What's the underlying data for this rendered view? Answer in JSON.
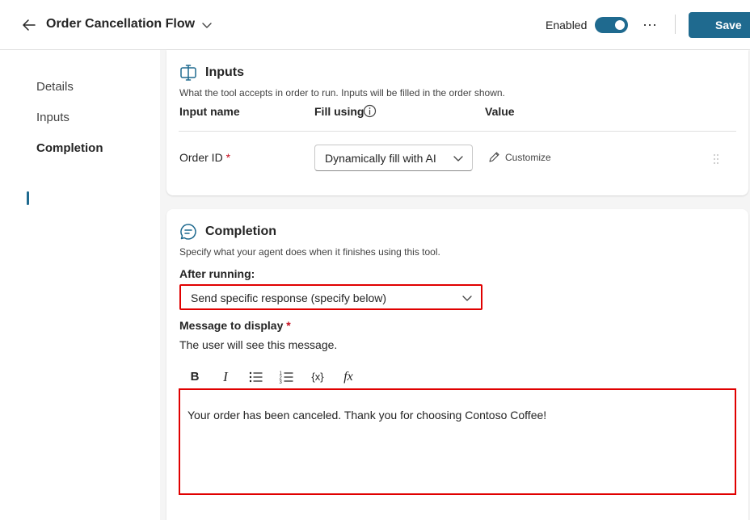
{
  "header": {
    "title": "Order Cancellation Flow",
    "enabled_label": "Enabled",
    "enabled": true,
    "more_label": "···",
    "save_label": "Save",
    "accent_color": "#1f6a8f"
  },
  "nav": {
    "items": [
      {
        "label": "Details",
        "active": false
      },
      {
        "label": "Inputs",
        "active": false
      },
      {
        "label": "Completion",
        "active": true
      }
    ]
  },
  "inputs": {
    "title": "Inputs",
    "description": "What the tool accepts in order to run. Inputs will be filled in the order shown.",
    "columns": [
      "Input name",
      "Fill using",
      "Value"
    ],
    "row": {
      "name": "Order ID",
      "required_mark": "*",
      "fill_using": "Dynamically fill with AI",
      "value_action": "Customize"
    }
  },
  "completion": {
    "title": "Completion",
    "description": "Specify what your agent does when it finishes using this tool.",
    "after_running_label": "After running:",
    "after_running_value": "Send specific response (specify below)",
    "message_label": "Message to display",
    "message_required_mark": "*",
    "message_help": "The user will see this message.",
    "toolbar": {
      "bold": "B",
      "italic": "I",
      "variable": "{x}",
      "formula": "fx"
    },
    "message_text": "Your order has been canceled. Thank you for choosing Contoso Coffee!"
  }
}
